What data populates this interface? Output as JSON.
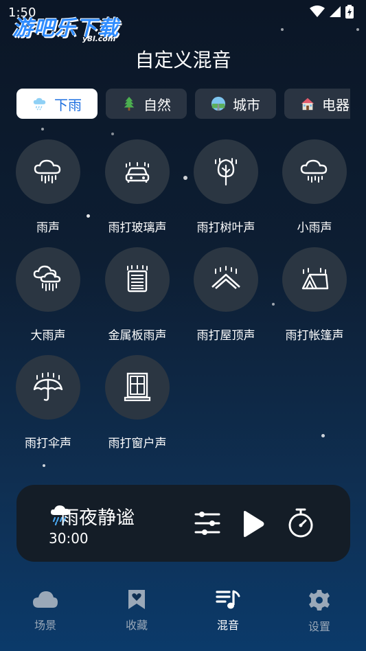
{
  "status": {
    "time": "1:50"
  },
  "watermark": {
    "main": "游吧乐下载",
    "sub": "y8l.com"
  },
  "page": {
    "title": "自定义混音"
  },
  "tabs": [
    {
      "label": "下雨",
      "icon": "rain-cloud-icon",
      "active": true
    },
    {
      "label": "自然",
      "icon": "tree-icon",
      "active": false
    },
    {
      "label": "城市",
      "icon": "city-road-icon",
      "active": false
    },
    {
      "label": "电器",
      "icon": "house-icon",
      "active": false
    }
  ],
  "sounds": [
    {
      "label": "雨声",
      "icon": "rain-cloud-icon"
    },
    {
      "label": "雨打玻璃声",
      "icon": "rain-on-car-icon"
    },
    {
      "label": "雨打树叶声",
      "icon": "rain-on-tree-icon"
    },
    {
      "label": "小雨声",
      "icon": "light-rain-icon"
    },
    {
      "label": "大雨声",
      "icon": "heavy-rain-icon"
    },
    {
      "label": "金属板雨声",
      "icon": "rain-on-metal-icon"
    },
    {
      "label": "雨打屋顶声",
      "icon": "rain-on-roof-icon"
    },
    {
      "label": "雨打帐篷声",
      "icon": "rain-on-tent-icon"
    },
    {
      "label": "雨打伞声",
      "icon": "rain-on-umbrella-icon"
    },
    {
      "label": "雨打窗户声",
      "icon": "rain-on-window-icon"
    }
  ],
  "player": {
    "title": "雨夜静谧",
    "time": "30:00",
    "icons": [
      "rain-cloud-icon",
      "mixer-sliders-icon",
      "play-icon",
      "timer-icon"
    ]
  },
  "nav": [
    {
      "label": "场景",
      "icon": "cloud-icon",
      "active": false
    },
    {
      "label": "收藏",
      "icon": "bookmark-heart-icon",
      "active": false
    },
    {
      "label": "混音",
      "icon": "music-list-icon",
      "active": true
    },
    {
      "label": "设置",
      "icon": "gear-icon",
      "active": false
    }
  ],
  "colors": {
    "accent": "#1d6fe0",
    "circle_bg": "#2b3642",
    "player_bg": "#141d27",
    "nav_inactive": "#9aa8b8"
  }
}
